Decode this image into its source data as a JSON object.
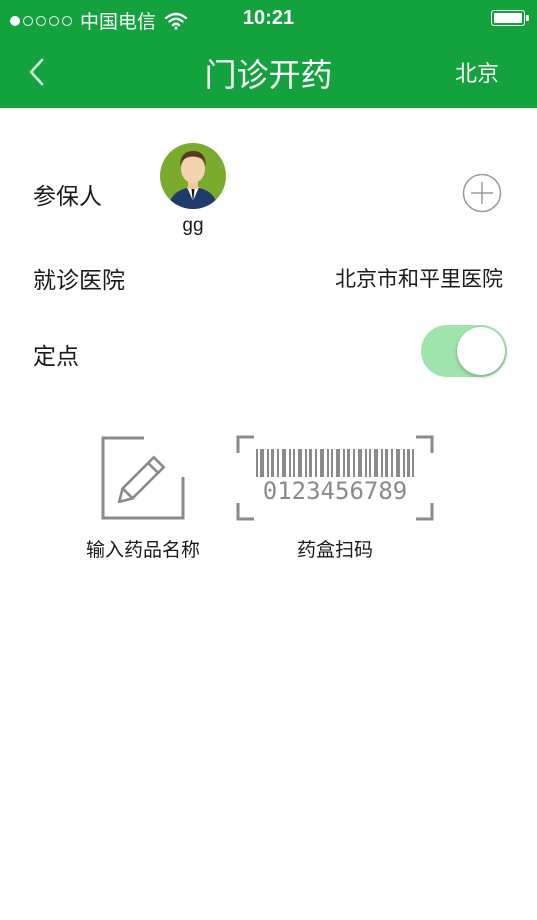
{
  "status_bar": {
    "carrier": "中国电信",
    "time": "10:21",
    "signal_dots_filled": 1,
    "signal_dots_total": 5,
    "battery_level": 1.0
  },
  "nav": {
    "back_icon": "chevron-left-icon",
    "title": "门诊开药",
    "city": "北京"
  },
  "insured": {
    "label": "参保人",
    "members": [
      {
        "name": "gg",
        "avatar_icon": "user-avatar-icon"
      }
    ],
    "add_icon": "plus-circle-icon"
  },
  "hospital": {
    "label": "就诊医院",
    "value": "北京市和平里医院"
  },
  "designated": {
    "label": "定点",
    "enabled": true
  },
  "actions": [
    {
      "label": "输入药品名称",
      "icon": "pencil-edit-icon"
    },
    {
      "label": "药盒扫码",
      "icon": "barcode-scan-icon",
      "barcode_number": "0123456789"
    }
  ],
  "colors": {
    "header": "#13a23d",
    "toggle_on": "#9fe3ad",
    "icon_gray": "#8a8a8a"
  }
}
